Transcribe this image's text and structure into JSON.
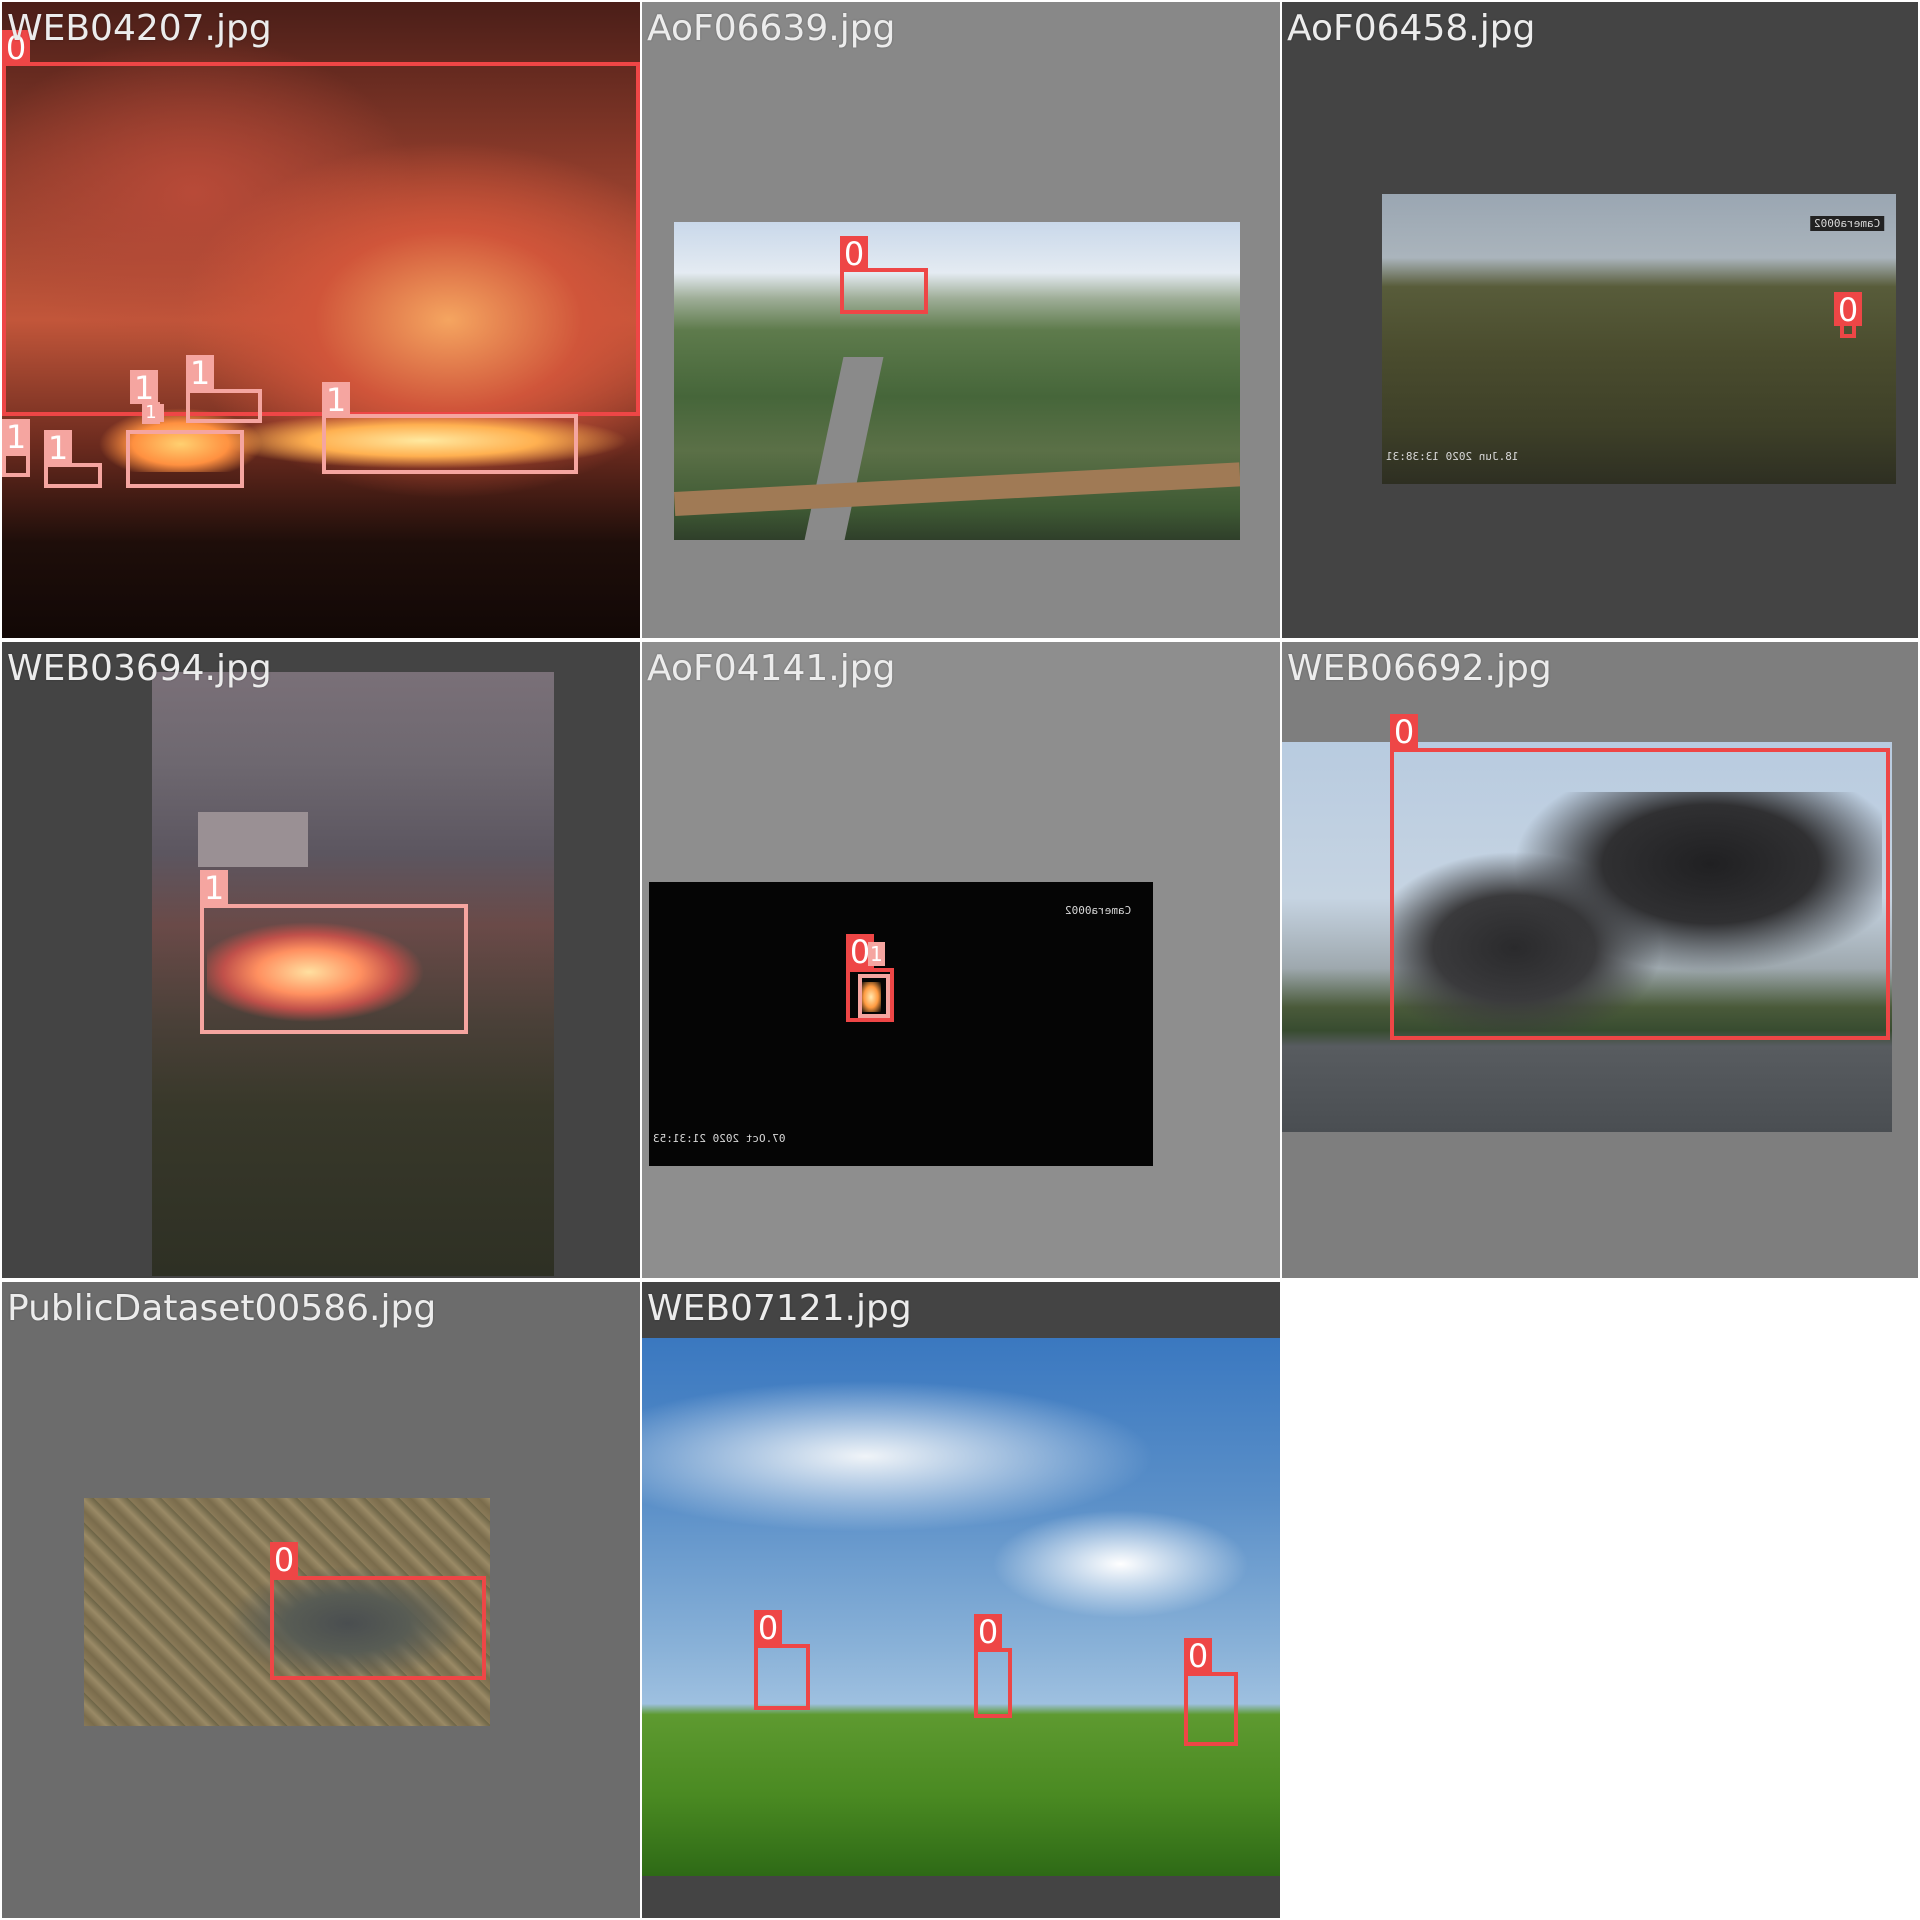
{
  "grid": {
    "tiles": [
      {
        "filename": "WEB04207.jpg",
        "labels": [
          "0",
          "1",
          "1",
          "1",
          "1",
          "1",
          "1"
        ]
      },
      {
        "filename": "AoF06639.jpg",
        "labels": [
          "0"
        ]
      },
      {
        "filename": "AoF06458.jpg",
        "labels": [
          "0"
        ],
        "camera": "Camera0002",
        "timestamp": "18.Jun 2020 13:38:31"
      },
      {
        "filename": "WEB03694.jpg",
        "labels": [
          "1"
        ]
      },
      {
        "filename": "AoF04141.jpg",
        "labels": [
          "0",
          "1"
        ],
        "camera": "Camera0002",
        "timestamp": "07.Oct 2020 21:31:53"
      },
      {
        "filename": "WEB06692.jpg",
        "labels": [
          "0"
        ]
      },
      {
        "filename": "PublicDataset00586.jpg",
        "labels": [
          "0"
        ]
      },
      {
        "filename": "WEB07121.jpg",
        "labels": [
          "0",
          "0",
          "0"
        ]
      }
    ]
  },
  "classes": {
    "smoke": "0",
    "fire": "1"
  },
  "colors": {
    "smoke_box": "#ee4646",
    "fire_box": "#f5a5a0",
    "divider": "#ffffff"
  }
}
